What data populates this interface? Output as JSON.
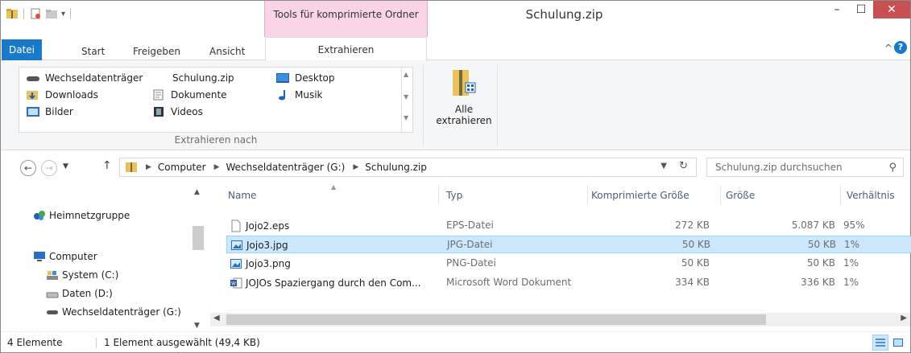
{
  "window": {
    "title": "Schulung.zip",
    "context_tab_header": "Tools für komprimierte Ordner",
    "minimize": "–",
    "maximize": "☐",
    "close": "✕"
  },
  "ribbon": {
    "tabs": {
      "file": "Datei",
      "start": "Start",
      "share": "Freigeben",
      "view": "Ansicht",
      "extract": "Extrahieren"
    },
    "collapse": "^",
    "help": "?",
    "extract_to_items": [
      "Wechseldatenträger",
      "Schulung.zip",
      "Desktop",
      "Downloads",
      "Dokumente",
      "Musik",
      "Bilder",
      "Videos"
    ],
    "group_label": "Extrahieren nach",
    "extract_all_line1": "Alle",
    "extract_all_line2": "extrahieren"
  },
  "address": {
    "crumbs": [
      "Computer",
      "Wechseldatenträger (G:)",
      "Schulung.zip"
    ],
    "search_placeholder": "Schulung.zip durchsuchen"
  },
  "nav_pane": {
    "items": [
      "Heimnetzgruppe",
      "Computer",
      "System (C:)",
      "Daten (D:)",
      "Wechseldatenträger (G:)"
    ]
  },
  "file_list": {
    "columns": [
      "Name",
      "Typ",
      "Komprimierte Größe",
      "Größe",
      "Verhältnis"
    ],
    "rows": [
      {
        "name": "Jojo2.eps",
        "type": "EPS-Datei",
        "compressed": "272 KB",
        "size": "5.087 KB",
        "ratio": "95%",
        "icon": "generic-file-icon"
      },
      {
        "name": "Jojo3.jpg",
        "type": "JPG-Datei",
        "compressed": "50 KB",
        "size": "50 KB",
        "ratio": "1%",
        "icon": "image-file-icon"
      },
      {
        "name": "Jojo3.png",
        "type": "PNG-Datei",
        "compressed": "50 KB",
        "size": "50 KB",
        "ratio": "1%",
        "icon": "image-file-icon"
      },
      {
        "name": "JOJOs Spaziergang durch den Com...",
        "type": "Microsoft Word Dokument",
        "compressed": "334 KB",
        "size": "336 KB",
        "ratio": "1%",
        "icon": "word-document-icon"
      }
    ]
  },
  "status": {
    "count": "4 Elemente",
    "selection": "1 Element ausgewählt (49,4 KB)"
  },
  "colors": {
    "accent": "#1979ca",
    "selection_bg": "#cce8ff",
    "context_tab": "#f9d3e6",
    "close_button": "#c75050"
  }
}
